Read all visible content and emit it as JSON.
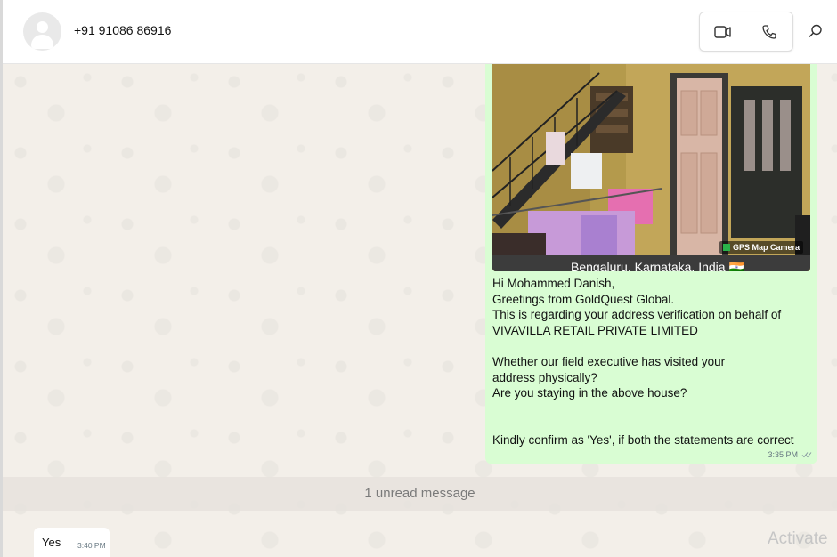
{
  "header": {
    "contact_name": "+91 91086 86916"
  },
  "message_out": {
    "photo": {
      "gps_label": "GPS Map Camera",
      "location": "Bengaluru, Karnataka, India 🇮🇳"
    },
    "lines": [
      "Hi Mohammed Danish,",
      "Greetings from GoldQuest Global.",
      "This is regarding your address verification on behalf of",
      "VIVAVILLA RETAIL PRIVATE LIMITED",
      "",
      "Whether our field executive has visited your address physically?",
      "Are you staying in the above house?",
      "",
      "",
      "Kindly confirm as 'Yes', if both the statements are correct"
    ],
    "time": "3:35 PM"
  },
  "unread": {
    "label": "1 unread message"
  },
  "message_in": {
    "text": "Yes",
    "time": "3:40 PM"
  },
  "watermark": {
    "text": "Activate"
  },
  "icons": {
    "avatar": "default-avatar-icon",
    "video": "video-call-icon",
    "voice": "voice-call-icon",
    "search": "search-icon",
    "ticks": "double-check-icon"
  },
  "colors": {
    "outgoing_bubble": "#d9fdd3",
    "chat_background": "#f3efe9",
    "meta_text": "#667781"
  }
}
